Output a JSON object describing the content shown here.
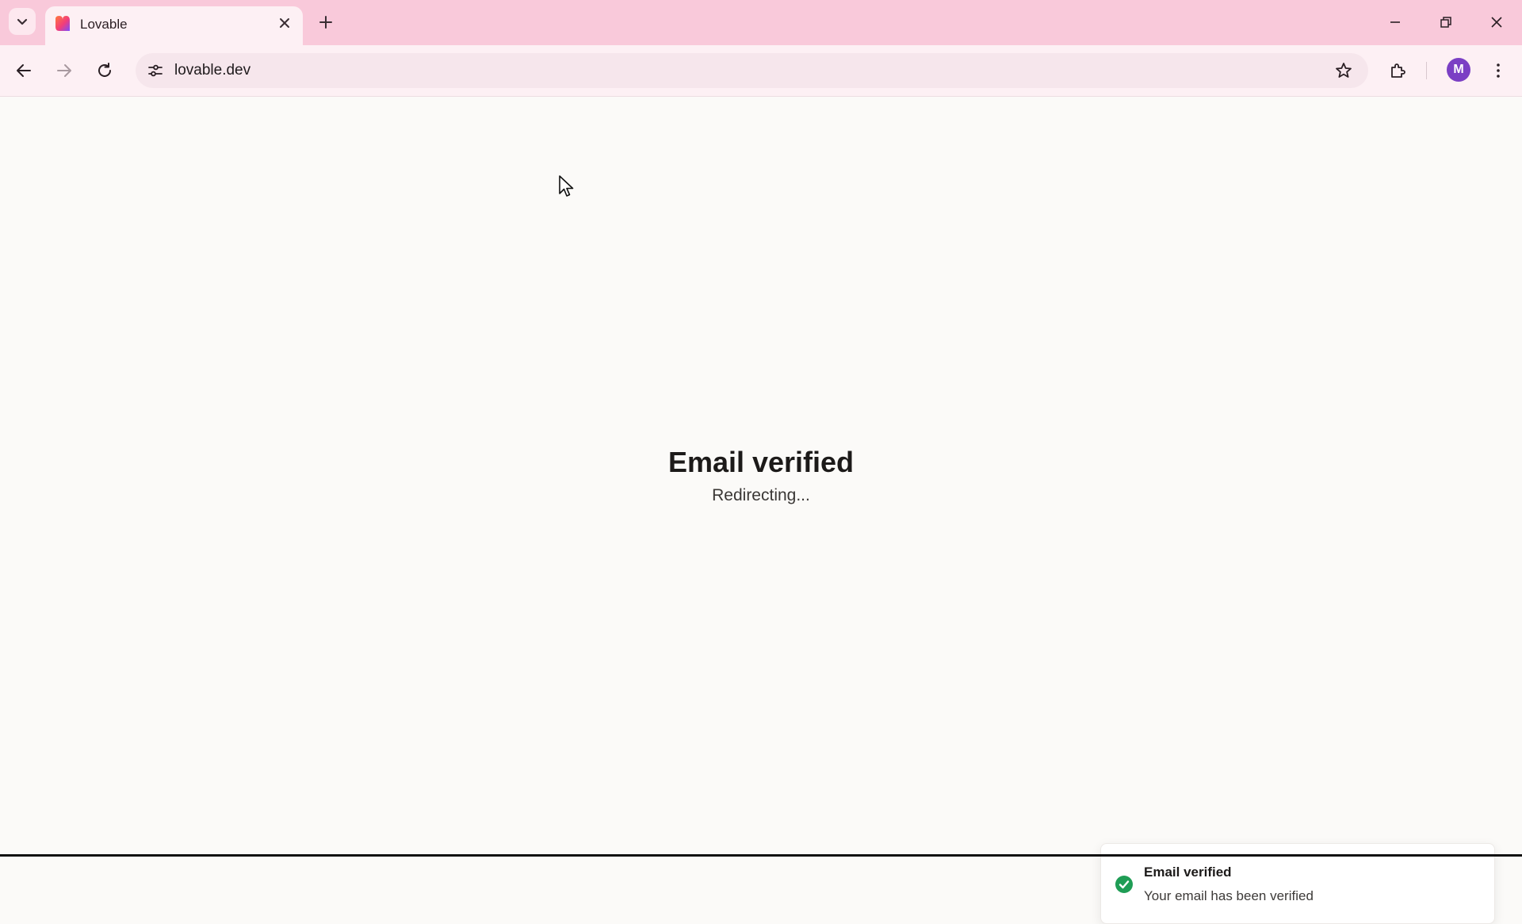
{
  "browser": {
    "tab": {
      "title": "Lovable"
    },
    "address_bar": {
      "url": "lovable.dev"
    },
    "profile": {
      "initial": "M",
      "color": "#7b3fc4"
    },
    "theme_color": "#f9c9da"
  },
  "page": {
    "heading": "Email verified",
    "status": "Redirecting..."
  },
  "toast": {
    "title": "Email verified",
    "description": "Your email has been verified",
    "icon": "check-circle-icon",
    "icon_color": "#1f9d55"
  }
}
